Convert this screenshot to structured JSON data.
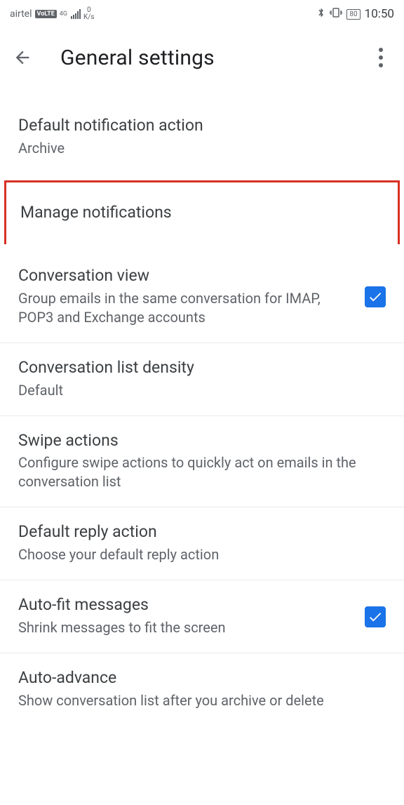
{
  "status": {
    "carrier": "airtel",
    "volte": "VoLTE",
    "network": "4G",
    "speed_top": "0",
    "speed_unit": "K/s",
    "battery": "80",
    "time": "10:50"
  },
  "header": {
    "title": "General settings"
  },
  "items": {
    "default_notif": {
      "title": "Default notification action",
      "sub": "Archive"
    },
    "manage_notif": {
      "title": "Manage notifications"
    },
    "conv_view": {
      "title": "Conversation view",
      "sub": "Group emails in the same conversation for IMAP, POP3 and Exchange accounts"
    },
    "list_density": {
      "title": "Conversation list density",
      "sub": "Default"
    },
    "swipe": {
      "title": "Swipe actions",
      "sub": "Configure swipe actions to quickly act on emails in the conversation list"
    },
    "reply": {
      "title": "Default reply action",
      "sub": "Choose your default reply action"
    },
    "autofit": {
      "title": "Auto-fit messages",
      "sub": "Shrink messages to fit the screen"
    },
    "advance": {
      "title": "Auto-advance",
      "sub": "Show conversation list after you archive or delete"
    }
  }
}
